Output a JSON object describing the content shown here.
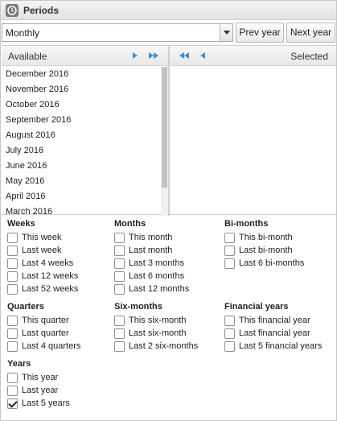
{
  "window": {
    "title": "Periods",
    "icon": "clock-icon"
  },
  "controls": {
    "period_type": "Monthly",
    "prev_year_label": "Prev year",
    "next_year_label": "Next year"
  },
  "available": {
    "header": "Available",
    "items": [
      "December 2016",
      "November 2016",
      "October 2016",
      "September 2016",
      "August 2016",
      "July 2016",
      "June 2016",
      "May 2016",
      "April 2016",
      "March 2016"
    ]
  },
  "selected": {
    "header": "Selected",
    "items": []
  },
  "groups": {
    "weeks": {
      "title": "Weeks",
      "options": [
        {
          "label": "This week",
          "checked": false
        },
        {
          "label": "Last week",
          "checked": false
        },
        {
          "label": "Last 4 weeks",
          "checked": false
        },
        {
          "label": "Last 12 weeks",
          "checked": false
        },
        {
          "label": "Last 52 weeks",
          "checked": false
        }
      ]
    },
    "months": {
      "title": "Months",
      "options": [
        {
          "label": "This month",
          "checked": false
        },
        {
          "label": "Last month",
          "checked": false
        },
        {
          "label": "Last 3 months",
          "checked": false
        },
        {
          "label": "Last 6 months",
          "checked": false
        },
        {
          "label": "Last 12 months",
          "checked": false
        }
      ]
    },
    "bimonths": {
      "title": "Bi-months",
      "options": [
        {
          "label": "This bi-month",
          "checked": false
        },
        {
          "label": "Last bi-month",
          "checked": false
        },
        {
          "label": "Last 6 bi-months",
          "checked": false
        }
      ]
    },
    "quarters": {
      "title": "Quarters",
      "options": [
        {
          "label": "This quarter",
          "checked": false
        },
        {
          "label": "Last quarter",
          "checked": false
        },
        {
          "label": "Last 4 quarters",
          "checked": false
        }
      ]
    },
    "sixmonths": {
      "title": "Six-months",
      "options": [
        {
          "label": "This six-month",
          "checked": false
        },
        {
          "label": "Last six-month",
          "checked": false
        },
        {
          "label": "Last 2 six-months",
          "checked": false
        }
      ]
    },
    "financial": {
      "title": "Financial years",
      "options": [
        {
          "label": "This financial year",
          "checked": false
        },
        {
          "label": "Last financial year",
          "checked": false
        },
        {
          "label": "Last 5 financial years",
          "checked": false
        }
      ]
    },
    "years": {
      "title": "Years",
      "options": [
        {
          "label": "This year",
          "checked": false
        },
        {
          "label": "Last year",
          "checked": false
        },
        {
          "label": "Last 5 years",
          "checked": true
        }
      ]
    }
  }
}
